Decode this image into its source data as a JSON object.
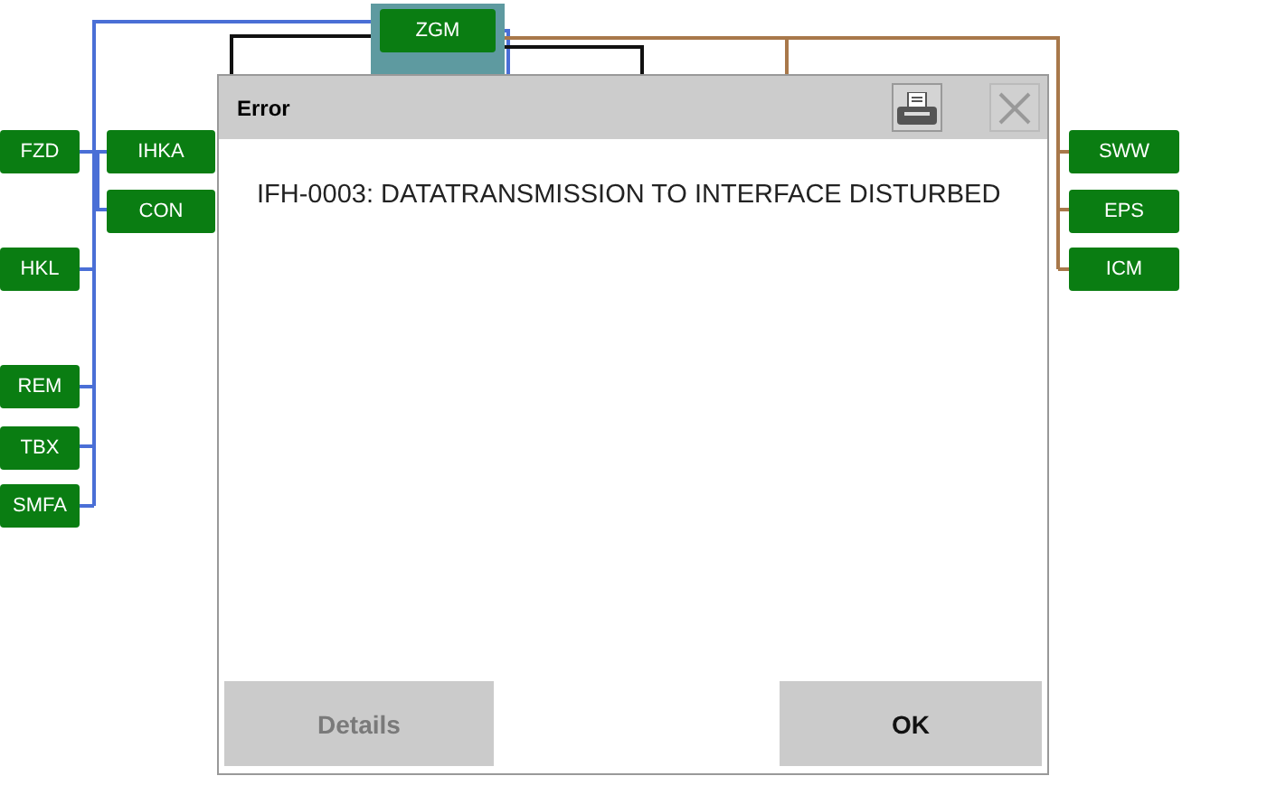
{
  "diagram": {
    "nodes": [
      {
        "label": "ZGM",
        "selected": true
      },
      {
        "label": "FZD",
        "selected": false
      },
      {
        "label": "IHKA",
        "selected": false
      },
      {
        "label": "CON",
        "selected": false
      },
      {
        "label": "HKL",
        "selected": false
      },
      {
        "label": "REM",
        "selected": false
      },
      {
        "label": "TBX",
        "selected": false
      },
      {
        "label": "SMFA",
        "selected": false
      },
      {
        "label": "SWW",
        "selected": false
      },
      {
        "label": "EPS",
        "selected": false
      },
      {
        "label": "ICM",
        "selected": false
      }
    ]
  },
  "dialog": {
    "title": "Error",
    "message": "IFH-0003: DATATRANSMISSION TO INTERFACE DISTURBED",
    "buttons": [
      {
        "label": "Details",
        "disabled": true
      },
      {
        "label": "OK",
        "disabled": false
      }
    ]
  }
}
